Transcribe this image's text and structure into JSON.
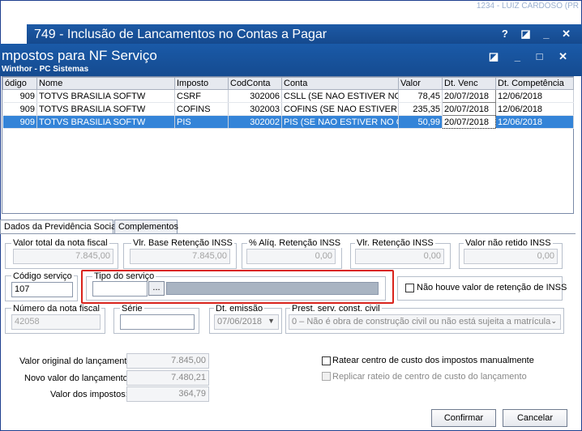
{
  "back_window": {
    "title": "749 - Inclusão de Lancamentos no Contas a Pagar",
    "user_text": "1234 - LUIZ CARDOSO (PR",
    "controls": "? ◪ _ ✕"
  },
  "front_window": {
    "title": "mpostos para NF Serviço",
    "subtitle": "Winthor - PC Sistemas",
    "controls": "◪ _ □ ✕"
  },
  "grid": {
    "columns": [
      "ódigo",
      "Nome",
      "Imposto",
      "CodConta",
      "Conta",
      "Valor",
      "Dt. Venc",
      "Dt. Competência"
    ],
    "rows": [
      {
        "codigo": "909",
        "nome": "TOTVS BRASILIA SOFTW",
        "imposto": "CSRF",
        "codconta": "302006",
        "conta": "CSLL (SE NAO ESTIVER NO CM",
        "valor": "78,45",
        "dtvenc": "20/07/2018",
        "dtcomp": "12/06/2018"
      },
      {
        "codigo": "909",
        "nome": "TOTVS BRASILIA SOFTW",
        "imposto": "COFINS",
        "codconta": "302003",
        "conta": "COFINS (SE NAO ESTIVER NO",
        "valor": "235,35",
        "dtvenc": "20/07/2018",
        "dtcomp": "12/06/2018"
      },
      {
        "codigo": "909",
        "nome": "TOTVS BRASILIA SOFTW",
        "imposto": "PIS",
        "codconta": "302002",
        "conta": "PIS (SE NAO ESTIVER NO CMV",
        "valor": "50,99",
        "dtvenc": "20/07/2018",
        "dtcomp": "12/06/2018"
      }
    ]
  },
  "tabs": [
    "Dados da Previdência Social",
    "Complementos"
  ],
  "form": {
    "valor_total_label": "Valor total da nota fiscal",
    "valor_total_value": "7.845,00",
    "base_retencao_label": "Vlr. Base Retenção INSS",
    "base_retencao_value": "7.845,00",
    "aliq_label": "% Alíq. Retenção INSS",
    "aliq_value": "0,00",
    "vlr_retencao_label": "Vlr. Retenção INSS",
    "vlr_retencao_value": "0,00",
    "nao_retido_label": "Valor não retido INSS",
    "nao_retido_value": "0,00",
    "codigo_servico_label": "Código serviço",
    "codigo_servico_value": "107",
    "tipo_servico_label": "Tipo do serviço",
    "tipo_servico_value": "",
    "lookup_button": "...",
    "sem_retencao_label": "Não houve valor de retenção de INSS",
    "numero_nf_label": "Número da nota fiscal",
    "numero_nf_value": "42058",
    "serie_label": "Série",
    "serie_value": "",
    "dt_emissao_label": "Dt. emissão",
    "dt_emissao_value": "07/06/2018",
    "prest_label": "Prest. serv. const. civil",
    "prest_value": "0 – Não é obra de construção civil ou não está sujeita a matrícula"
  },
  "summary": {
    "original_label": "Valor original do lançamento:",
    "original_value": "7.845,00",
    "novo_label": "Novo valor do lançamento:",
    "novo_value": "7.480,21",
    "impostos_label": "Valor dos impostos:",
    "impostos_value": "364,79",
    "ratear_label": "Ratear centro de custo dos impostos manualmente",
    "replicar_label": "Replicar rateio de centro de custo do lançamento"
  },
  "buttons": {
    "confirmar": "Confirmar",
    "cancelar": "Cancelar"
  }
}
